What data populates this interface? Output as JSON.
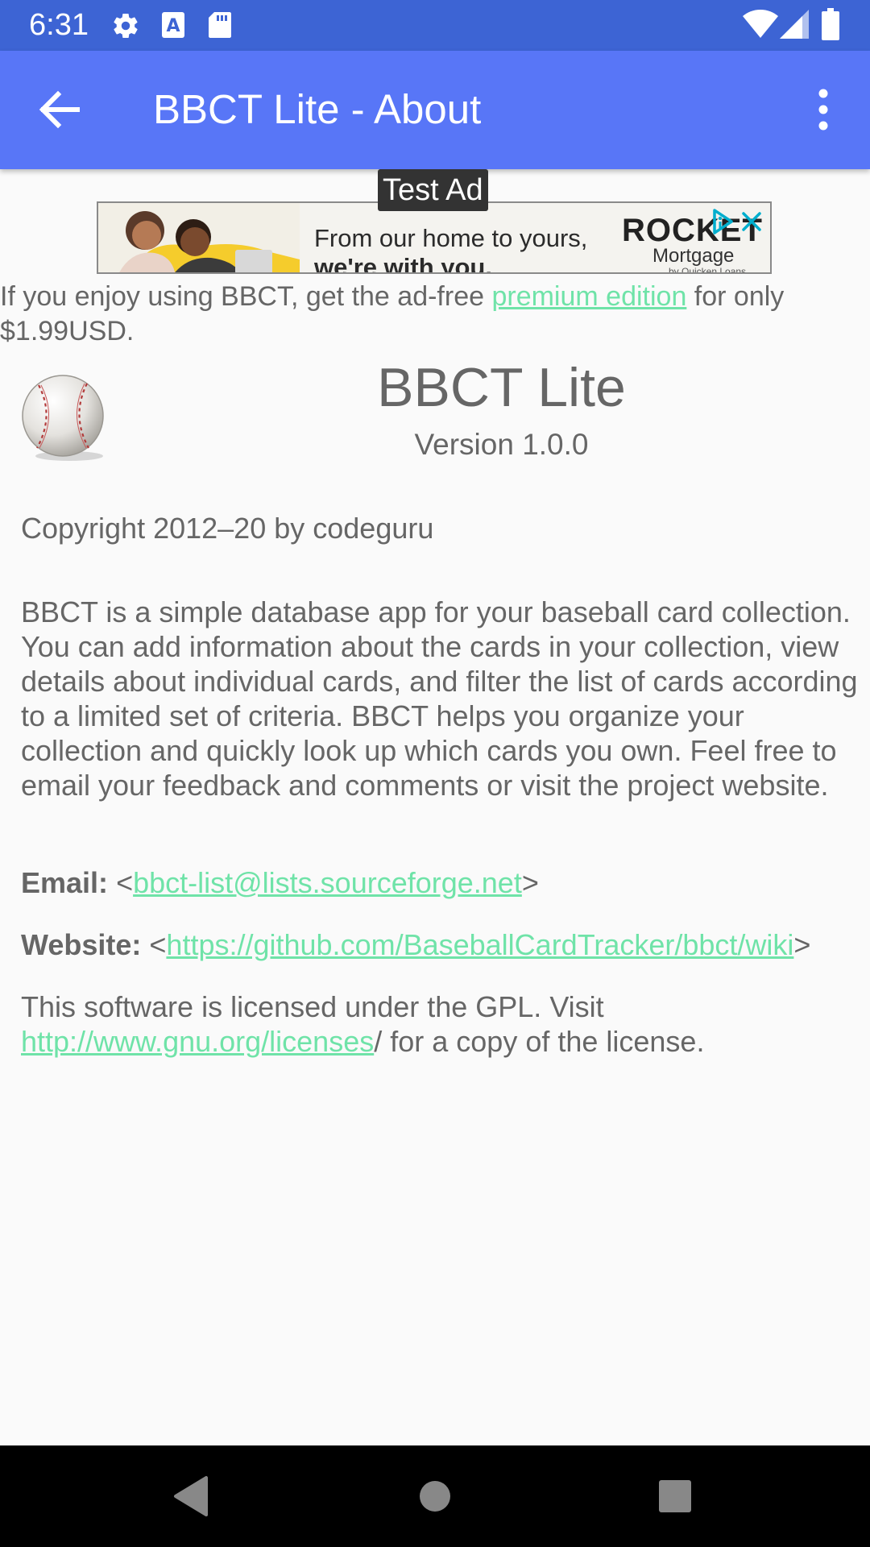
{
  "status_bar": {
    "time": "6:31",
    "icons": [
      "gear-icon",
      "text-a-icon",
      "sd-card-icon",
      "wifi-icon",
      "signal-icon",
      "battery-icon"
    ]
  },
  "app_bar": {
    "title": "BBCT Lite - About",
    "back_icon": "arrow-back-icon",
    "overflow_icon": "more-vert-icon"
  },
  "ad": {
    "label": "Test Ad",
    "headline": "From our home to yours,",
    "headline_2": "we're with you.",
    "brand": "ROCKET",
    "brand_sub": "Mortgage",
    "brand_sub_2": "by Quicken Loans"
  },
  "premium": {
    "text_before": "If you enjoy using BBCT, get the ad-free ",
    "link": "premium edition",
    "text_after": " for only $1.99USD."
  },
  "about": {
    "app_name": "BBCT Lite",
    "version": "Version 1.0.0",
    "copyright": "Copyright 2012–20 by codeguru",
    "description": "BBCT is a simple database app for your baseball card collection. You can add information about the cards in your collection, view details about individual cards, and filter the list of cards according to a limited set of criteria. BBCT helps you organize your collection and quickly look up which cards you own. Feel free to email your feedback and comments or visit the project website.",
    "email_label": "Email:",
    "email": "bbct-list@lists.sourceforge.net",
    "website_label": "Website:",
    "website": "https://github.com/BaseballCardTracker/bbct/wiki",
    "license_before": "This software is licensed under the GPL. Visit ",
    "license_link": "http://www.gnu.org/licenses",
    "license_after": "/ for a copy of the license.",
    "open_bracket": "<",
    "close_bracket": ">"
  },
  "colors": {
    "status_bar": "#3d64d4",
    "app_bar": "#5876f7",
    "link": "#6fe3a8",
    "text": "#666666",
    "background": "#fafafa"
  },
  "nav_bar": {
    "icons": [
      "back-triangle-icon",
      "home-circle-icon",
      "recents-square-icon"
    ]
  }
}
